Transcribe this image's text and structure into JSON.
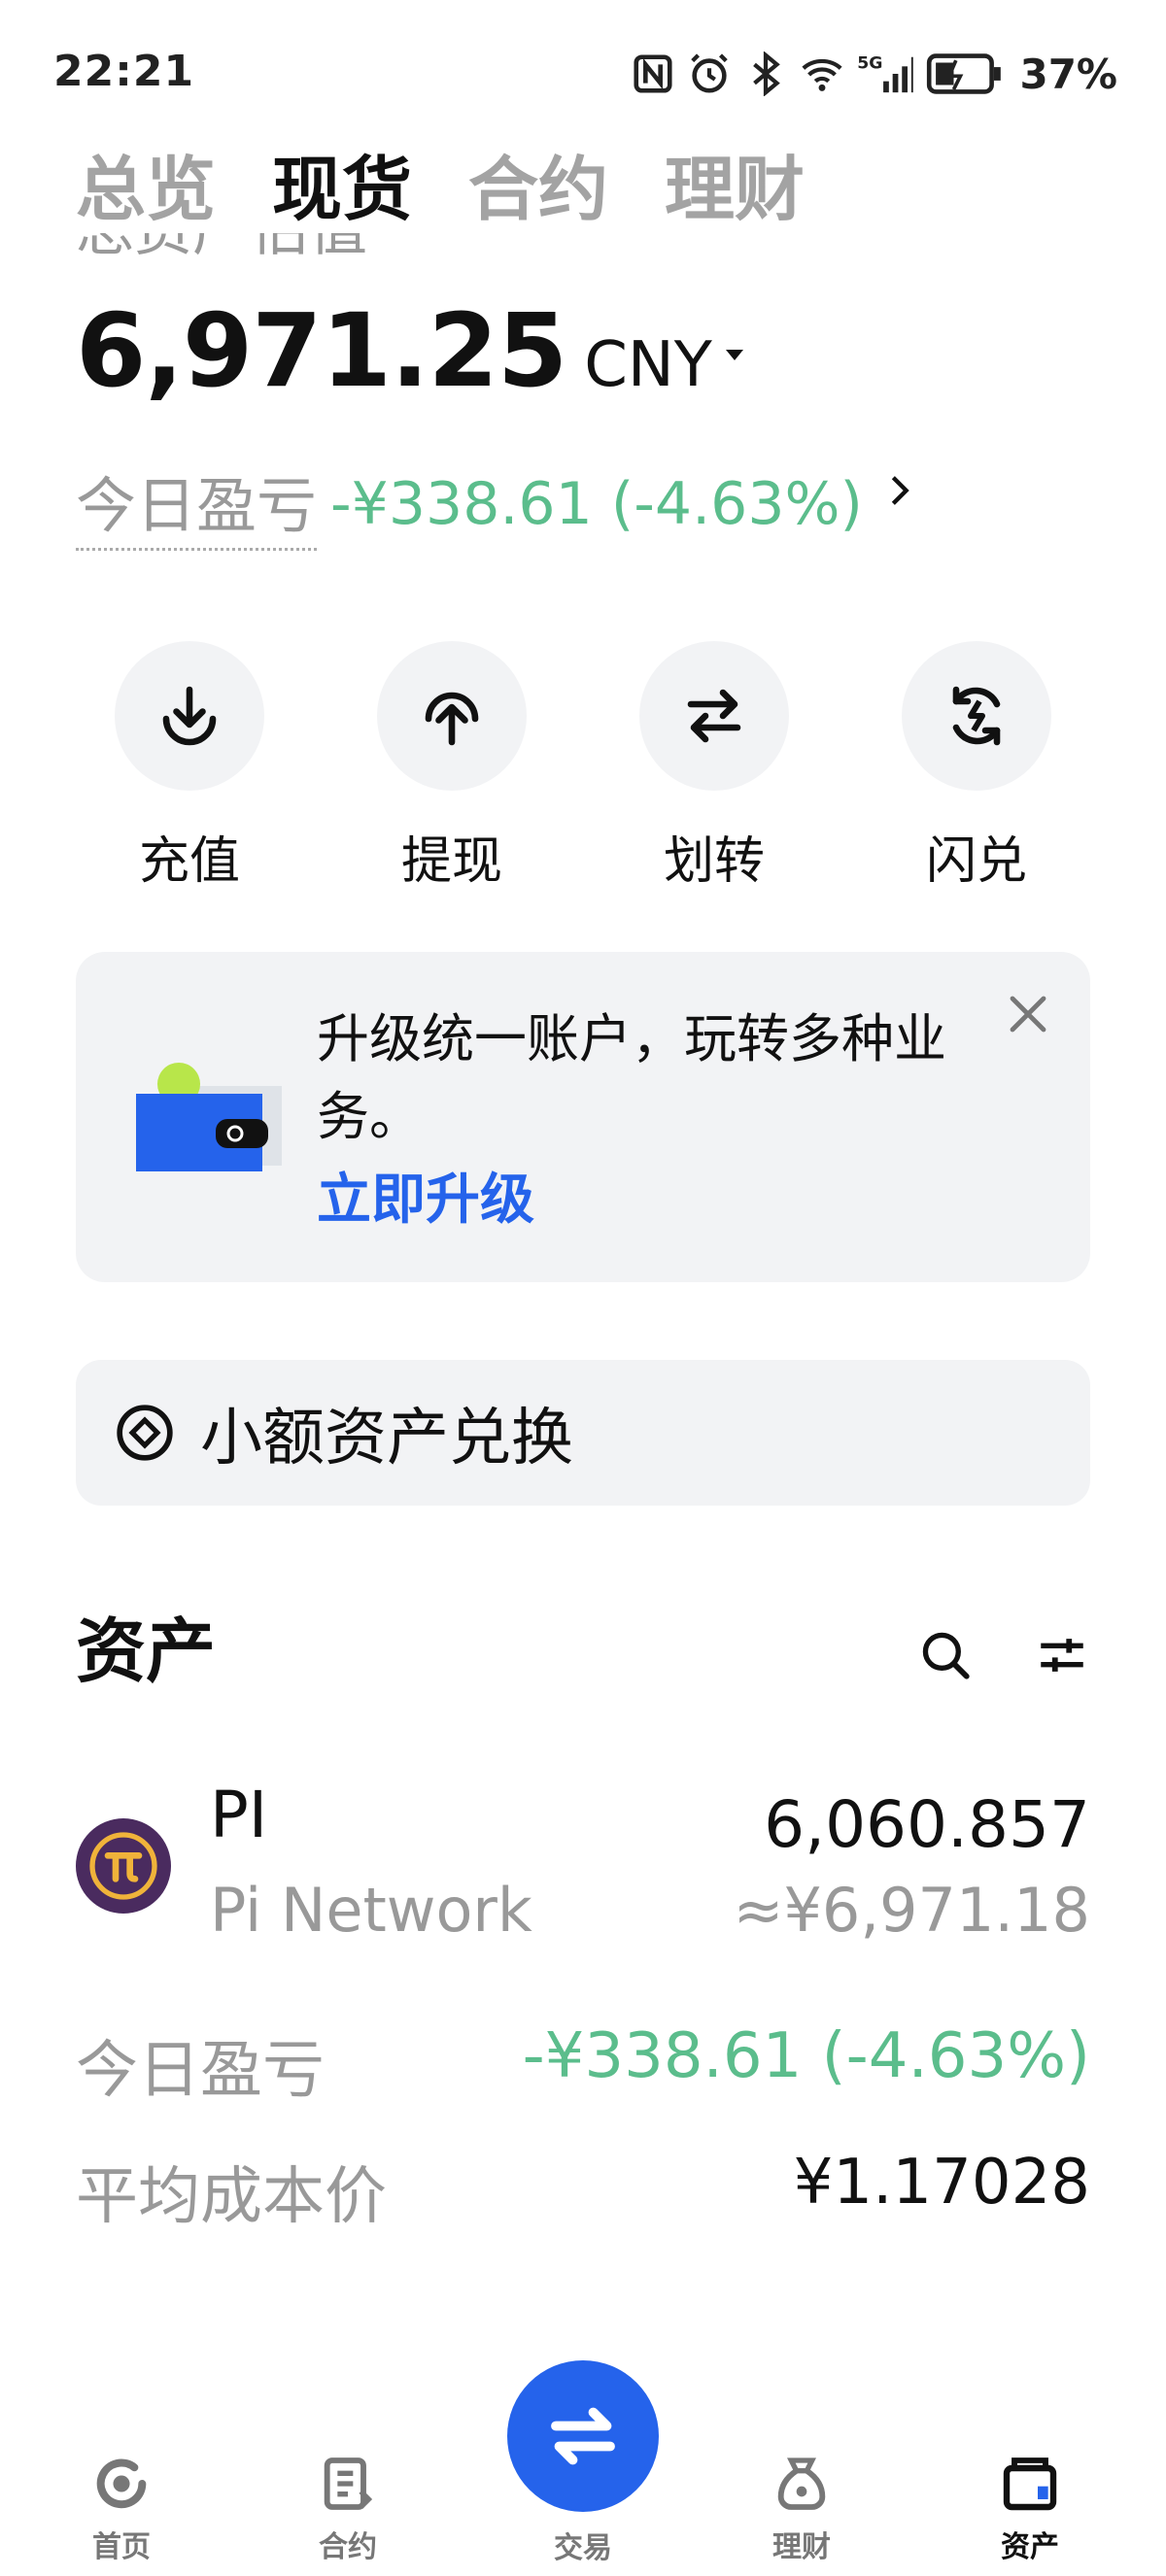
{
  "status_bar": {
    "time": "22:21",
    "battery": "37%"
  },
  "tabs": [
    {
      "label": "总览"
    },
    {
      "label": "现货"
    },
    {
      "label": "合约"
    },
    {
      "label": "理财"
    }
  ],
  "clipped_label": "总资产估值",
  "balance": {
    "amount": "6,971.25",
    "currency": "CNY"
  },
  "daily_pnl": {
    "label": "今日盈亏",
    "value": "-¥338.61 (-4.63%)"
  },
  "actions": [
    {
      "label": "充值",
      "icon": "deposit-icon"
    },
    {
      "label": "提现",
      "icon": "withdraw-icon"
    },
    {
      "label": "划转",
      "icon": "transfer-icon"
    },
    {
      "label": "闪兑",
      "icon": "flash-convert-icon"
    }
  ],
  "banner": {
    "text": "升级统一账户，玩转多种业务。",
    "link": "立即升级"
  },
  "small_asset_convert": {
    "label": "小额资产兑换"
  },
  "assets": {
    "title": "资产",
    "items": [
      {
        "symbol": "PI",
        "name": "Pi Network",
        "quantity": "6,060.857",
        "cny_value": "≈¥6,971.18",
        "daily_pnl_label": "今日盈亏",
        "daily_pnl_value": "-¥338.61 (-4.63%)",
        "avg_cost_label": "平均成本价",
        "avg_cost_value": "¥1.17028"
      }
    ]
  },
  "bottom_nav": [
    {
      "label": "首页"
    },
    {
      "label": "合约"
    },
    {
      "label": "交易"
    },
    {
      "label": "理财"
    },
    {
      "label": "资产"
    }
  ],
  "colors": {
    "accent": "#2563eb",
    "loss_green": "#5bbd8c",
    "muted": "#999999",
    "card_bg": "#f2f3f5"
  }
}
